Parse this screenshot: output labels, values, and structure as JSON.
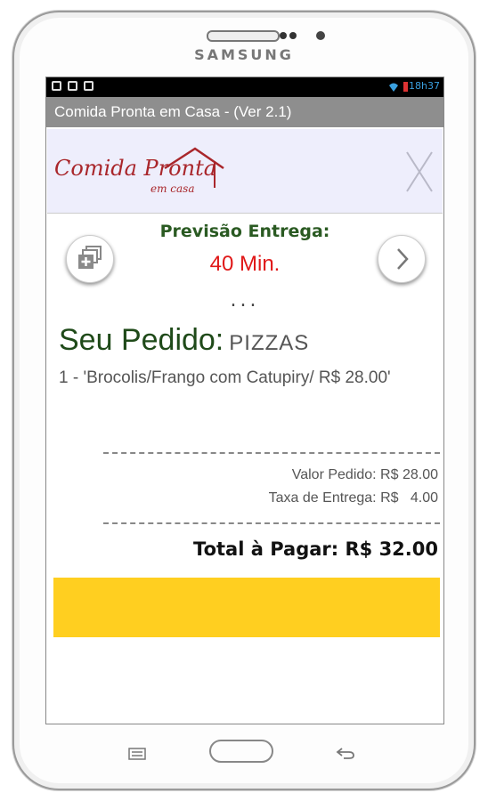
{
  "device": {
    "brand": "SAMSUNG"
  },
  "statusbar": {
    "time": "18h37"
  },
  "app": {
    "title": "Comida Pronta em Casa - (Ver 2.1)"
  },
  "banner": {
    "logo_text": "Comida Pronta",
    "logo_sub": "em casa"
  },
  "delivery": {
    "label": "Previsão Entrega:",
    "value": "40 Min.",
    "dots": "..."
  },
  "order": {
    "title": "Seu Pedido:",
    "category": "PIZZAS",
    "items": [
      "1 - 'Brocolis/Frango com Catupiry/ R$ 28.00'"
    ]
  },
  "summary": {
    "valor_pedido": "Valor Pedido: R$ 28.00",
    "taxa_entrega": "Taxa de Entrega: R$   4.00",
    "total": "Total à Pagar: R$ 32.00"
  },
  "colors": {
    "accent_yellow": "#ffcf20",
    "price_red": "#e01818",
    "heading_green": "#1f4a19"
  },
  "icons": [
    "add-to-list-icon",
    "chevron-right-icon",
    "close-icon",
    "menu-key-icon",
    "back-key-icon"
  ]
}
